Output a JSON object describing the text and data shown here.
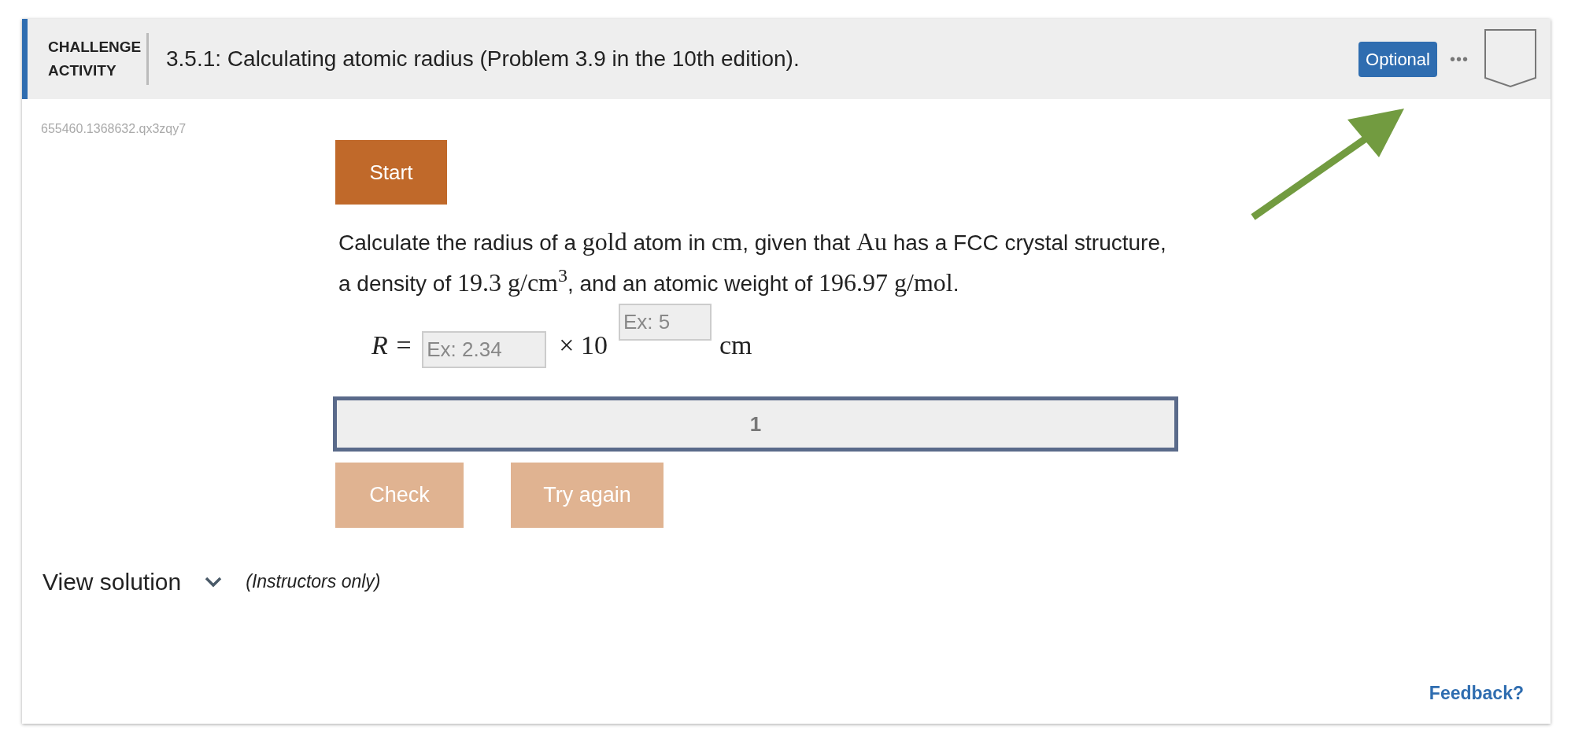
{
  "header": {
    "label": "CHALLENGE ACTIVITY",
    "title": "3.5.1: Calculating atomic radius (Problem 3.9 in the 10th edition).",
    "badge": "Optional",
    "more": "•••",
    "bookmarked": false
  },
  "activity_id": "655460.1368632.qx3zqy7",
  "start_button": {
    "label": "Start",
    "disabled": false
  },
  "question": [
    {
      "kind": "text",
      "text": "Calculate the radius of a "
    },
    {
      "kind": "math",
      "text": "gold"
    },
    {
      "kind": "text",
      "text": " atom in "
    },
    {
      "kind": "math",
      "text": "cm"
    },
    {
      "kind": "text",
      "text": ", given that "
    },
    {
      "kind": "math",
      "text": "Au"
    },
    {
      "kind": "text",
      "text": " has a FCC crystal structure, a density of "
    },
    {
      "kind": "math",
      "text": "19.3 g/cm$^{3}$"
    },
    {
      "kind": "text",
      "text": ", and an atomic weight of "
    },
    {
      "kind": "math",
      "text": "196.97 g/mol"
    },
    {
      "kind": "text",
      "text": "."
    }
  ],
  "equation": {
    "lhs": "R =",
    "mantissa": {
      "placeholder": "Ex: 2.34"
    },
    "times": "× 10",
    "exponent": {
      "placeholder": "Ex: 5"
    },
    "unit": "cm"
  },
  "progress": {
    "label": "1"
  },
  "buttons": [
    {
      "label": "Check",
      "disabled": true
    },
    {
      "label": "Try again",
      "disabled": true
    }
  ],
  "solution": {
    "label": "View solution",
    "expanded": false,
    "note": "(Instructors only)"
  },
  "feedback": "Feedback?"
}
